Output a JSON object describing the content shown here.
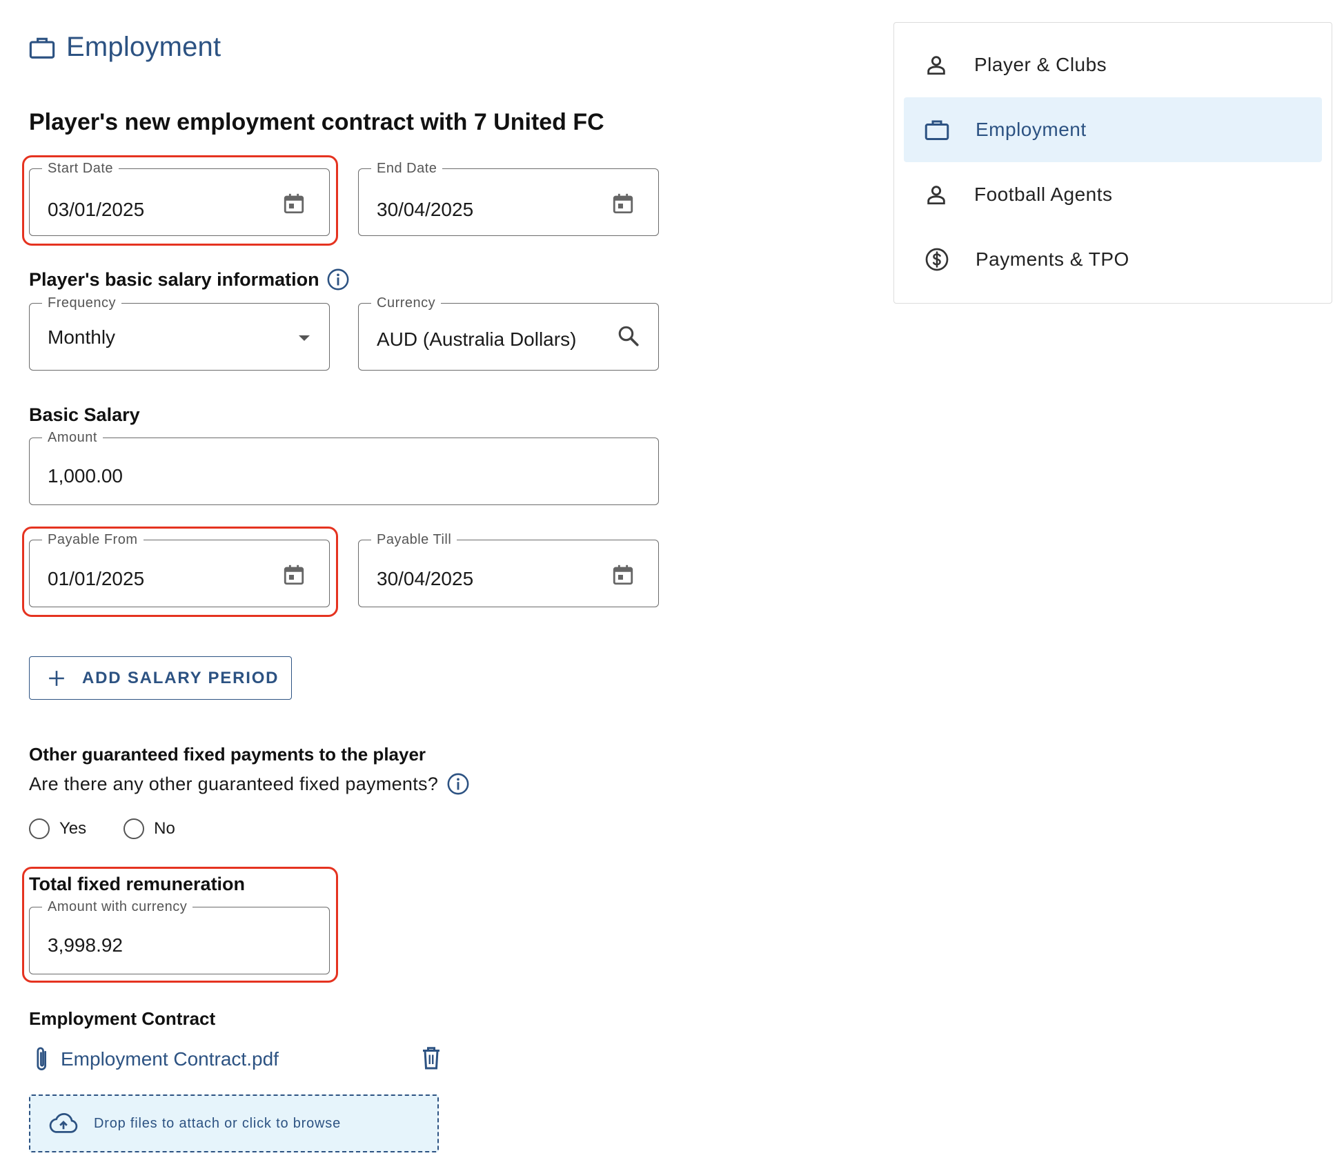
{
  "page": {
    "title": "Employment",
    "title_icon": "briefcase-icon"
  },
  "contract_heading": "Player's new employment contract with 7 United FC",
  "dates": {
    "start": {
      "label": "Start Date",
      "value": "03/01/2025"
    },
    "end": {
      "label": "End Date",
      "value": "30/04/2025"
    }
  },
  "salary_info": {
    "heading": "Player's basic salary information",
    "frequency": {
      "label": "Frequency",
      "value": "Monthly"
    },
    "currency": {
      "label": "Currency",
      "value": "AUD (Australia Dollars)"
    }
  },
  "basic_salary": {
    "heading": "Basic Salary",
    "amount": {
      "label": "Amount",
      "value": "1,000.00"
    },
    "payable_from": {
      "label": "Payable From",
      "value": "01/01/2025"
    },
    "payable_till": {
      "label": "Payable Till",
      "value": "30/04/2025"
    },
    "add_label": "ADD SALARY PERIOD"
  },
  "other_payments": {
    "heading": "Other guaranteed fixed payments to the player",
    "question": "Are there any other guaranteed fixed payments?",
    "options": [
      "Yes",
      "No"
    ]
  },
  "total": {
    "heading": "Total fixed remuneration",
    "label": "Amount with currency",
    "value": "3,998.92"
  },
  "contract_file": {
    "heading": "Employment Contract",
    "filename": "Employment Contract.pdf",
    "drop_text": "Drop files to attach or click to browse"
  },
  "nav": {
    "items": [
      {
        "label": "Player & Clubs",
        "icon": "person-icon"
      },
      {
        "label": "Employment",
        "icon": "briefcase-icon"
      },
      {
        "label": "Football Agents",
        "icon": "person-icon"
      },
      {
        "label": "Payments & TPO",
        "icon": "dollar-circle-icon"
      }
    ],
    "active": "Employment"
  },
  "colors": {
    "accent": "#2c5282",
    "highlight": "#e53320",
    "active_bg": "#e6f2fb",
    "dropzone_bg": "#e6f4fb"
  }
}
